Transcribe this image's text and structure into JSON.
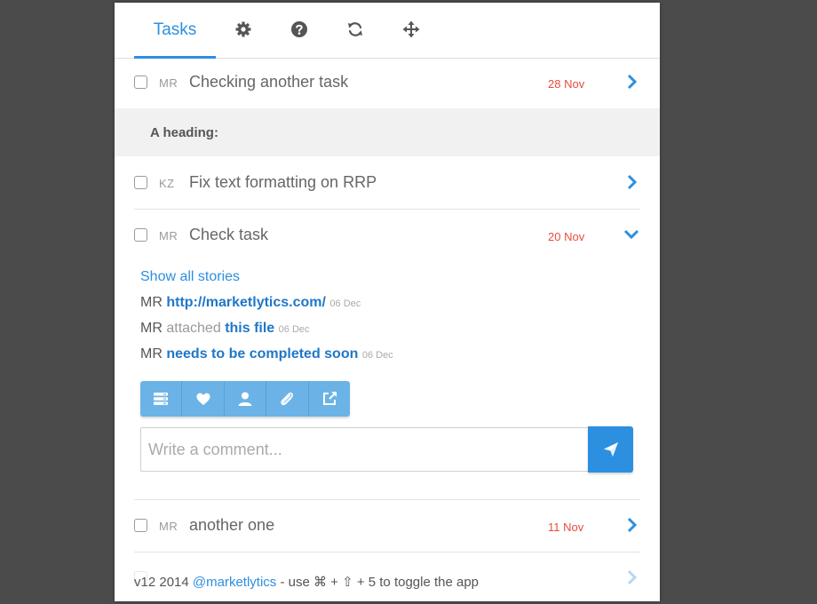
{
  "tabs": {
    "tasks_label": "Tasks"
  },
  "toolbar_icons": [
    "gear-icon",
    "help-icon",
    "refresh-icon",
    "move-icon"
  ],
  "tasks": [
    {
      "initials": "MR",
      "title": "Checking another task",
      "date": "28 Nov",
      "expanded": false
    },
    {
      "initials": "KZ",
      "title": "Fix text formatting on RRP",
      "date": "",
      "expanded": false
    },
    {
      "initials": "MR",
      "title": "Check task",
      "date": "20 Nov",
      "expanded": true
    },
    {
      "initials": "MR",
      "title": "another one",
      "date": "11 Nov",
      "expanded": false
    }
  ],
  "heading": "A heading:",
  "detail": {
    "show_all": "Show all stories",
    "stories": [
      {
        "who": "MR",
        "verb": "",
        "link": "http://marketlytics.com/",
        "date": "06 Dec"
      },
      {
        "who": "MR",
        "verb": "attached",
        "link": "this file",
        "date": "06 Dec"
      },
      {
        "who": "MR",
        "verb": "",
        "link": "needs to be completed soon",
        "date": "06 Dec"
      }
    ],
    "action_icons": [
      "list-icon",
      "heart-icon",
      "user-icon",
      "paperclip-icon",
      "share-icon"
    ],
    "comment_placeholder": "Write a comment..."
  },
  "footer": {
    "version": "v12 2014",
    "handle": "@marketlytics",
    "hint": "- use ⌘ + ⇧ + 5 to toggle the app"
  },
  "colors": {
    "accent": "#2d8fe0",
    "date_red": "#e84c3d",
    "toolbar_blue": "#6bb3e6",
    "background": "#4b4b4b"
  }
}
